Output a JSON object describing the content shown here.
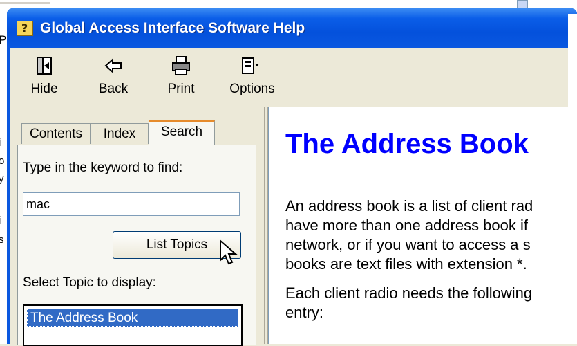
{
  "background": {
    "left_chars": [
      "P",
      "i",
      "o",
      "y",
      "i",
      "s"
    ]
  },
  "window": {
    "title": "Global Access Interface Software Help",
    "icon_char": "?"
  },
  "toolbar": {
    "hide_label": "Hide",
    "back_label": "Back",
    "print_label": "Print",
    "options_label": "Options",
    "hide_icon": "hide-icon",
    "back_icon": "back-arrow-icon",
    "print_icon": "printer-icon",
    "options_icon": "options-icon"
  },
  "tabs": {
    "contents": "Contents",
    "index": "Index",
    "search": "Search"
  },
  "search": {
    "keyword_label": "Type in the keyword to find:",
    "keyword_value": "mac",
    "list_topics_label": "List Topics",
    "select_topic_label": "Select Topic to display:",
    "topics": [
      "The Address Book"
    ]
  },
  "document": {
    "title": "The Address Book",
    "paragraph1": [
      "An address book is a list of client rad",
      "have more than one address book if",
      "network, or if you want to access a s",
      "books are text files with extension *."
    ],
    "paragraph2": [
      "Each client radio needs the following",
      "entry:"
    ]
  },
  "colors": {
    "titlebar": "#0a58e0",
    "doc_title": "#0000ff",
    "selection": "#316ac5"
  }
}
